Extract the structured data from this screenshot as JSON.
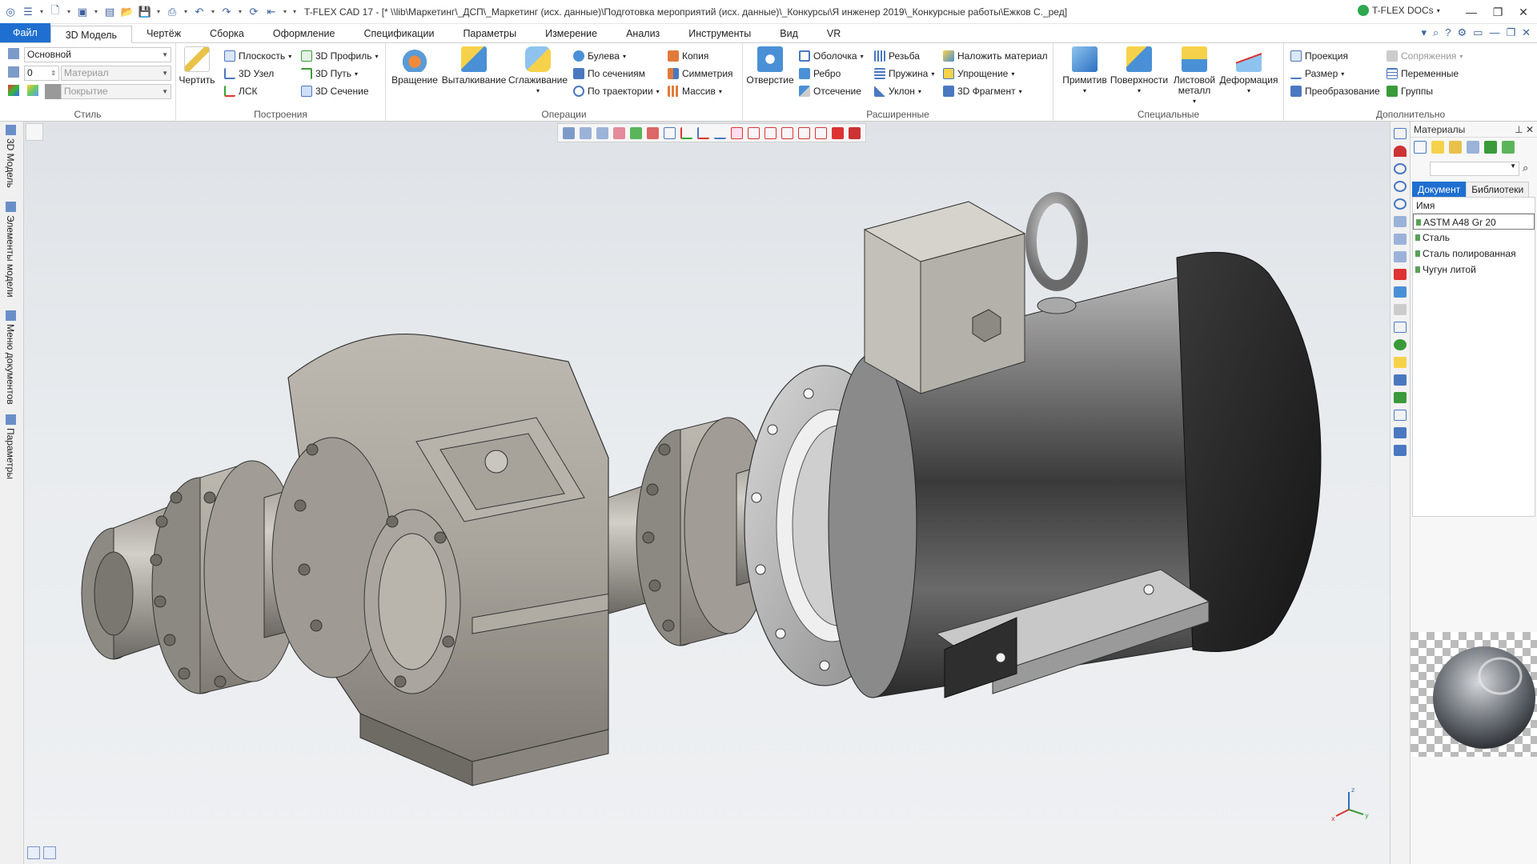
{
  "title": "T-FLEX CAD 17 - [* \\\\lib\\Маркетинг\\_ДСП\\_Маркетинг (исх. данные)\\Подготовка мероприятий (исх. данные)\\_Конкурсы\\Я инженер 2019\\_Конкурсные работы\\Ежков С._ред]",
  "docs_label": "T-FLEX DOCs",
  "window": {
    "minimize": "—",
    "restore": "❐",
    "close": "✕"
  },
  "menu": [
    "Файл",
    "3D Модель",
    "Чертёж",
    "Сборка",
    "Оформление",
    "Спецификации",
    "Параметры",
    "Измерение",
    "Анализ",
    "Инструменты",
    "Вид",
    "VR"
  ],
  "ribbon": {
    "style": {
      "label": "Стиль",
      "layer": "Основной",
      "priority": "0",
      "material_placeholder": "Материал",
      "cover_placeholder": "Покрытие"
    },
    "build": {
      "label": "Построения",
      "draw": "Чертить",
      "items": [
        "Плоскость",
        "3D Узел",
        "ЛСК",
        "3D Профиль",
        "3D Путь",
        "3D Сечение"
      ]
    },
    "operations": {
      "label": "Операции",
      "large": [
        "Вращение",
        "Выталкивание",
        "Сглаживание"
      ],
      "small": [
        "Булева",
        "По сечениям",
        "По траектории",
        "Копия",
        "Симметрия",
        "Массив"
      ]
    },
    "extended": {
      "label": "Расширенные",
      "large": [
        "Отверстие"
      ],
      "small": [
        "Оболочка",
        "Ребро",
        "Отсечение",
        "Резьба",
        "Пружина",
        "Уклон",
        "Наложить материал",
        "Упрощение",
        "3D Фрагмент"
      ]
    },
    "special": {
      "label": "Специальные",
      "large": [
        "Примитив",
        "Поверхности",
        "Листовой металл",
        "Деформация"
      ]
    },
    "extra": {
      "label": "Дополнительно",
      "small": [
        "Проекция",
        "Размер",
        "Преобразование",
        "Сопряжения",
        "Переменные",
        "Группы"
      ]
    }
  },
  "left_tabs": [
    "3D Модель",
    "Элементы модели",
    "Меню документов",
    "Параметры"
  ],
  "panel": {
    "title": "Материалы",
    "tabs": [
      "Документ",
      "Библиотеки"
    ],
    "column": "Имя",
    "items": [
      "ASTM A48 Gr 20",
      "Сталь",
      "Сталь полированная",
      "Чугун литой"
    ]
  },
  "axis_labels": {
    "z": "z",
    "x": "x",
    "y": "y"
  }
}
